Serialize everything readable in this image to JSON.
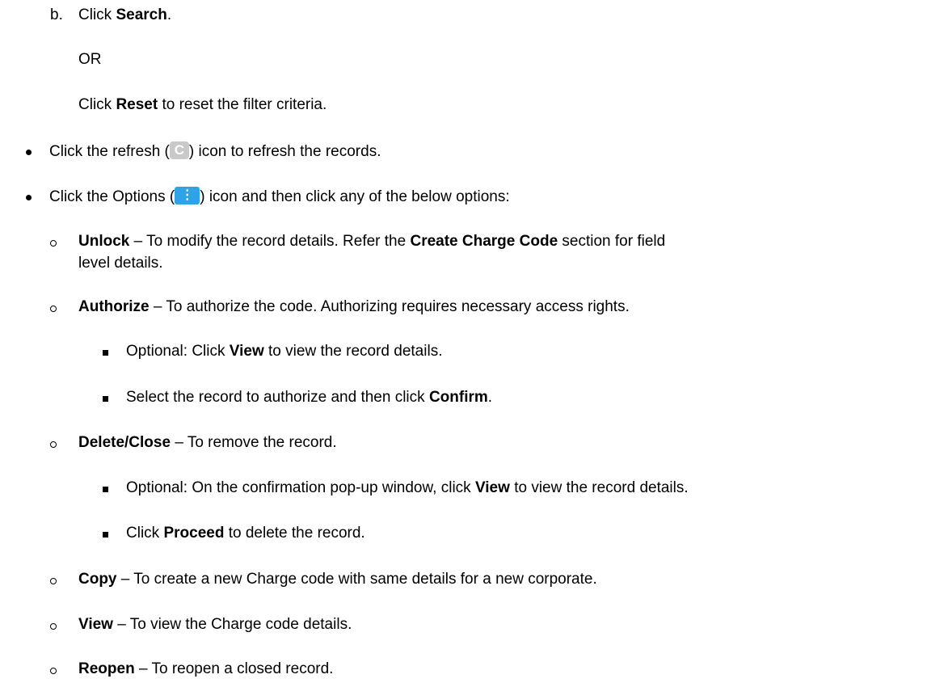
{
  "step_b": {
    "letter": "b.",
    "pre": "Click ",
    "bold": "Search",
    "post": "."
  },
  "or_text": "OR",
  "reset_line": {
    "pre": "Click ",
    "bold": "Reset",
    "post": " to reset the filter criteria."
  },
  "refresh_line": {
    "pre": "Click the refresh (",
    "post": ") icon to refresh the records.",
    "icon": "refresh-icon"
  },
  "options_line": {
    "pre": "Click the Options (",
    "post": ") icon and then click any of the below options:",
    "icon": "options-icon"
  },
  "unlock": {
    "bold": "Unlock",
    "mid": " – To modify the record details. Refer the ",
    "bold2": "Create Charge Code",
    "post": " section for field",
    "cont": "level details."
  },
  "authorize": {
    "bold": "Authorize",
    "post": " – To authorize the code. Authorizing requires necessary access rights.",
    "sub1": {
      "pre": "Optional: Click ",
      "bold": "View",
      "post": " to view the record details."
    },
    "sub2": {
      "pre": "Select the record to authorize and then click ",
      "bold": "Confirm",
      "post": "."
    }
  },
  "delete_close": {
    "bold": "Delete/Close",
    "post": " – To remove the record.",
    "sub1": {
      "pre": "Optional: On the confirmation pop-up window, click ",
      "bold": "View",
      "post": " to view the record details."
    },
    "sub2": {
      "pre": "Click ",
      "bold": "Proceed",
      "post": " to delete the record."
    }
  },
  "copy": {
    "bold": "Copy",
    "post": " – To create a new Charge code with same details for a new corporate."
  },
  "view": {
    "bold": "View",
    "post": " – To view the Charge code details."
  },
  "reopen": {
    "bold": "Reopen",
    "post": " – To reopen a closed record."
  }
}
